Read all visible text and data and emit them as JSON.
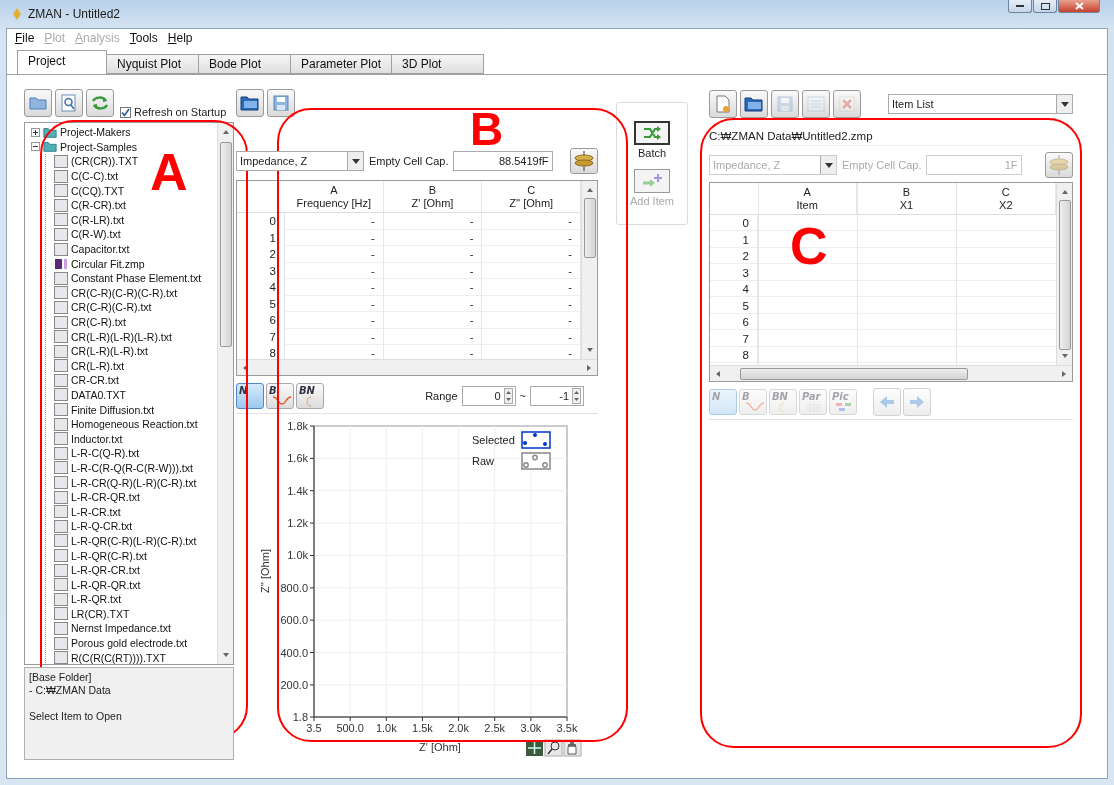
{
  "window": {
    "title": "ZMAN - Untitled2"
  },
  "menu": [
    {
      "label": "File",
      "disabled": false
    },
    {
      "label": "Plot",
      "disabled": true
    },
    {
      "label": "Analysis",
      "disabled": true
    },
    {
      "label": "Tools",
      "disabled": false
    },
    {
      "label": "Help",
      "disabled": false
    }
  ],
  "tabs": [
    {
      "label": "Project",
      "selected": true
    },
    {
      "label": "Nyquist Plot",
      "selected": false
    },
    {
      "label": "Bode Plot",
      "selected": false
    },
    {
      "label": "Parameter Plot",
      "selected": false
    },
    {
      "label": "3D Plot",
      "selected": false
    }
  ],
  "project_panel": {
    "toolbar": [
      {
        "kind": "folder"
      },
      {
        "kind": "search"
      },
      {
        "kind": "refresh"
      }
    ],
    "refresh_on_startup": {
      "label": "Refresh on Startup",
      "checked": true
    },
    "tree": [
      {
        "label": "Project-Makers",
        "expanded": false
      },
      {
        "label": "Project-Samples",
        "expanded": true,
        "children": [
          {
            "label": "(CR(CR)).TXT",
            "kind": "file"
          },
          {
            "label": "C(C-C).txt",
            "kind": "file"
          },
          {
            "label": "C(CQ).TXT",
            "kind": "file"
          },
          {
            "label": "C(R-CR).txt",
            "kind": "file"
          },
          {
            "label": "C(R-LR).txt",
            "kind": "file"
          },
          {
            "label": "C(R-W).txt",
            "kind": "file"
          },
          {
            "label": "Capacitor.txt",
            "kind": "file"
          },
          {
            "label": "Circular Fit.zmp",
            "kind": "project"
          },
          {
            "label": "Constant Phase Element.txt",
            "kind": "file"
          },
          {
            "label": "CR(C-R)(C-R)(C-R).txt",
            "kind": "file"
          },
          {
            "label": "CR(C-R)(C-R).txt",
            "kind": "file"
          },
          {
            "label": "CR(C-R).txt",
            "kind": "file"
          },
          {
            "label": "CR(L-R)(L-R)(L-R).txt",
            "kind": "file"
          },
          {
            "label": "CR(L-R)(L-R).txt",
            "kind": "file"
          },
          {
            "label": "CR(L-R).txt",
            "kind": "file"
          },
          {
            "label": "CR-CR.txt",
            "kind": "file"
          },
          {
            "label": "DATA0.TXT",
            "kind": "file"
          },
          {
            "label": "Finite Diffusion.txt",
            "kind": "file"
          },
          {
            "label": "Homogeneous Reaction.txt",
            "kind": "file"
          },
          {
            "label": "Inductor.txt",
            "kind": "file"
          },
          {
            "label": "L-R-C(Q-R).txt",
            "kind": "file"
          },
          {
            "label": "L-R-C(R-Q(R-C(R-W))).txt",
            "kind": "file"
          },
          {
            "label": "L-R-CR(Q-R)(L-R)(C-R).txt",
            "kind": "file"
          },
          {
            "label": "L-R-CR-QR.txt",
            "kind": "file"
          },
          {
            "label": "L-R-CR.txt",
            "kind": "file"
          },
          {
            "label": "L-R-Q-CR.txt",
            "kind": "file"
          },
          {
            "label": "L-R-QR(C-R)(L-R)(C-R).txt",
            "kind": "file"
          },
          {
            "label": "L-R-QR(C-R).txt",
            "kind": "file"
          },
          {
            "label": "L-R-QR-CR.txt",
            "kind": "file"
          },
          {
            "label": "L-R-QR-QR.txt",
            "kind": "file"
          },
          {
            "label": "L-R-QR.txt",
            "kind": "file"
          },
          {
            "label": "LR(CR).TXT",
            "kind": "file"
          },
          {
            "label": "Nernst Impedance.txt",
            "kind": "file"
          },
          {
            "label": "Porous gold electrode.txt",
            "kind": "file"
          },
          {
            "label": "R(C(R(C(RT)))).TXT",
            "kind": "file"
          }
        ]
      }
    ],
    "info": {
      "lines": [
        "[Base Folder]",
        "- C:₩ZMAN Data"
      ],
      "hint": "Select Item to Open"
    }
  },
  "data_panel": {
    "toolbar": [
      {
        "kind": "open"
      },
      {
        "kind": "save"
      }
    ],
    "quantity": "Impedance, Z",
    "cap_label": "Empty Cell Cap.",
    "cap_value": "88.5419fF",
    "table": {
      "columns": [
        {
          "letter": "A",
          "label": "Frequency [Hz]"
        },
        {
          "letter": "B",
          "label": "Z' [Ohm]"
        },
        {
          "letter": "C",
          "label": "Z'' [Ohm]"
        }
      ],
      "rows": [
        {
          "label": "0",
          "cells": [
            "-",
            "-",
            "-"
          ]
        },
        {
          "label": "1",
          "cells": [
            "-",
            "-",
            "-"
          ]
        },
        {
          "label": "2",
          "cells": [
            "-",
            "-",
            "-"
          ]
        },
        {
          "label": "3",
          "cells": [
            "-",
            "-",
            "-"
          ]
        },
        {
          "label": "4",
          "cells": [
            "-",
            "-",
            "-"
          ]
        },
        {
          "label": "5",
          "cells": [
            "-",
            "-",
            "-"
          ]
        },
        {
          "label": "6",
          "cells": [
            "-",
            "-",
            "-"
          ]
        },
        {
          "label": "7",
          "cells": [
            "-",
            "-",
            "-"
          ]
        },
        {
          "label": "8",
          "cells": [
            "-",
            "-",
            "-"
          ]
        }
      ]
    },
    "plot_modes": [
      {
        "label": "N",
        "selected": true
      },
      {
        "label": "B",
        "selected": false
      },
      {
        "label": "BN",
        "selected": false
      }
    ],
    "range": {
      "label": "Range",
      "from": "0",
      "separator": "~",
      "to": "-1"
    },
    "chart_data": {
      "type": "scatter",
      "xlabel": "Z' [Ohm]",
      "ylabel": "Z'' [Ohm]",
      "grid": true,
      "ylim": [
        1.8,
        1800
      ],
      "categories": [
        "3.5",
        "500.0",
        "1.0k",
        "1.5k",
        "2.0k",
        "2.5k",
        "3.0k",
        "3.5k"
      ],
      "yticks": [
        {
          "value": 1.8,
          "label": "1.8"
        },
        {
          "value": 200,
          "label": "200.0"
        },
        {
          "value": 400,
          "label": "400.0"
        },
        {
          "value": 600,
          "label": "600.0"
        },
        {
          "value": 800,
          "label": "800.0"
        },
        {
          "value": 1000,
          "label": "1.0k"
        },
        {
          "value": 1200,
          "label": "1.2k"
        },
        {
          "value": 1400,
          "label": "1.4k"
        },
        {
          "value": 1600,
          "label": "1.6k"
        },
        {
          "value": 1800,
          "label": "1.8k"
        }
      ],
      "series": [
        {
          "name": "Selected",
          "color": "#0033cc",
          "values": [
            null,
            null,
            null,
            null,
            null,
            null,
            null,
            null
          ]
        },
        {
          "name": "Raw",
          "values": [
            null,
            null,
            null,
            null,
            null,
            null,
            null,
            null
          ]
        }
      ]
    }
  },
  "batch_panel": {
    "buttons": [
      {
        "kind": "batch",
        "label": "Batch",
        "disabled": false
      },
      {
        "kind": "add",
        "label": "Add Item",
        "disabled": true
      }
    ]
  },
  "item_panel": {
    "toolbar": [
      {
        "kind": "new",
        "disabled": false
      },
      {
        "kind": "open",
        "disabled": false
      },
      {
        "kind": "save",
        "disabled": true
      },
      {
        "kind": "list",
        "disabled": true
      },
      {
        "kind": "delete",
        "disabled": true
      }
    ],
    "list_select": "Item List",
    "path": "C:₩ZMAN Data₩Untitled2.zmp",
    "inputs_disabled": true,
    "quantity": "Impedance, Z",
    "cap_label": "Empty Cell Cap.",
    "cap_value": "1F",
    "table": {
      "columns": [
        {
          "letter": "A",
          "label": "Item"
        },
        {
          "letter": "B",
          "label": "X1"
        },
        {
          "letter": "C",
          "label": "X2"
        }
      ],
      "rows": [
        {
          "label": "0"
        },
        {
          "label": "1"
        },
        {
          "label": "2"
        },
        {
          "label": "3"
        },
        {
          "label": "4"
        },
        {
          "label": "5"
        },
        {
          "label": "6"
        },
        {
          "label": "7"
        },
        {
          "label": "8"
        }
      ]
    },
    "tools_disabled": true,
    "plot_modes": [
      {
        "label": "N",
        "selected": true
      },
      {
        "label": "B",
        "selected": false
      },
      {
        "label": "BN",
        "selected": false
      },
      {
        "label": "Par",
        "selected": false
      },
      {
        "label": "Pic",
        "selected": false
      }
    ],
    "nav": [
      {
        "kind": "back"
      },
      {
        "kind": "forward"
      }
    ]
  },
  "annotations": [
    {
      "label": "A"
    },
    {
      "label": "B"
    },
    {
      "label": "C"
    }
  ]
}
